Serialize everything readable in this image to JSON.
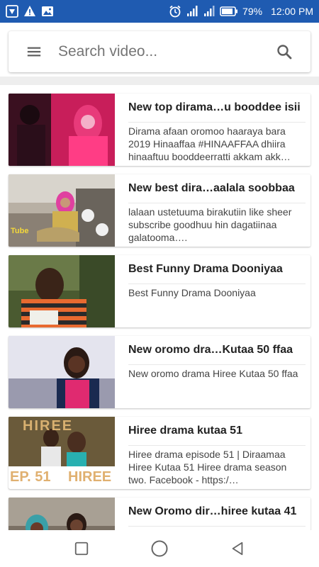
{
  "status_bar": {
    "battery": "79%",
    "time": "12:00 PM",
    "color": "#1f5bb1"
  },
  "search": {
    "placeholder": "Search video..."
  },
  "videos": [
    {
      "title": "New top dirama…u booddee isii",
      "description": "Dirama afaan oromoo haaraya bara 2019 Hinaaffaa #HINAAFFAA dhiira hinaaftuu booddeerratti akkam akk…"
    },
    {
      "title": "New best dira…aalala soobbaa",
      "description": "lalaan ustetuuma birakutiin like sheer subscribe goodhuu hin dagatiinaa galatooma…."
    },
    {
      "title": "Best Funny Drama Dooniyaa",
      "description": "Best Funny Drama Dooniyaa"
    },
    {
      "title": "New oromo dra…Kutaa 50 ffaa",
      "description": "New oromo drama Hiree Kutaa 50 ffaa"
    },
    {
      "title": "Hiree drama kutaa 51",
      "description": "Hiree drama episode 51 | Diraamaa Hiree Kutaa 51 Hiree drama season two. Facebook - https:/…",
      "thumb_text": {
        "top": "HIREE",
        "bottom_left": "EP. 51",
        "bottom_right": "HIREE"
      }
    },
    {
      "title": "New Oromo dir…hiree kutaa 41",
      "description": ""
    }
  ],
  "thumb_overlays": {
    "video_2": "Tube"
  }
}
